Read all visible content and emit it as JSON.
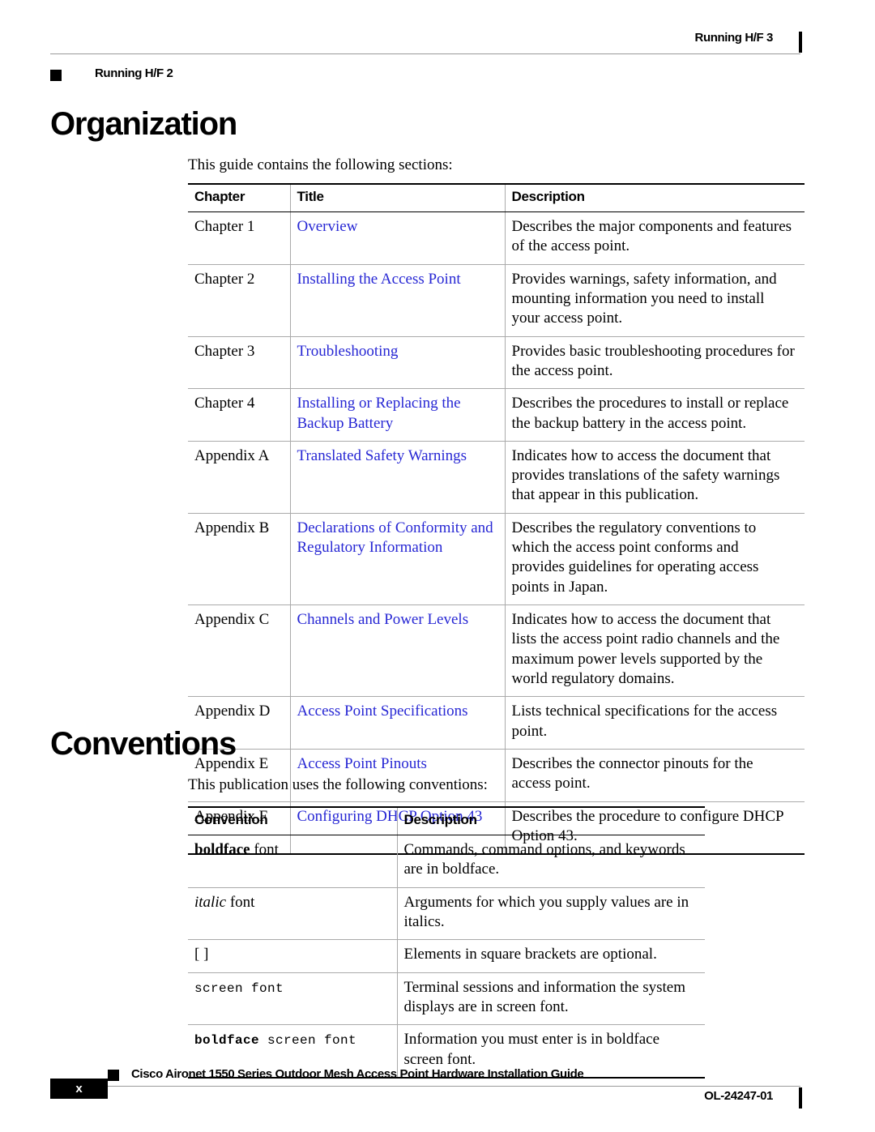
{
  "header": {
    "left_text": "Running H/F 2",
    "right_text": "Running H/F 3"
  },
  "footer": {
    "page_number": "x",
    "guide_title": "Cisco Aironet 1550 Series Outdoor Mesh Access Point Hardware Installation Guide",
    "doc_number": "OL-24247-01"
  },
  "colors": {
    "link": "#2727d4",
    "rule": "#9a9a9a",
    "text": "#000000"
  },
  "organization": {
    "title": "Organization",
    "lead": "This guide contains the following sections:",
    "headers": [
      "Chapter",
      "Title",
      "Description"
    ],
    "rows": [
      {
        "chapter": "Chapter 1",
        "title": "Overview",
        "description": "Describes the major components and features of the access point."
      },
      {
        "chapter": "Chapter 2",
        "title": "Installing the Access Point",
        "description": "Provides warnings, safety information, and mounting information you need to install your access point."
      },
      {
        "chapter": "Chapter 3",
        "title": "Troubleshooting",
        "description": "Provides basic troubleshooting procedures for the access point."
      },
      {
        "chapter": "Chapter 4",
        "title": "Installing or Replacing the Backup Battery",
        "description": "Describes the procedures to install or replace the backup battery in the access point."
      },
      {
        "chapter": "Appendix A",
        "title": "Translated Safety Warnings",
        "description": "Indicates how to access the document that provides translations of the safety warnings that appear in this publication."
      },
      {
        "chapter": "Appendix B",
        "title": "Declarations of Conformity and Regulatory Information",
        "description": "Describes the regulatory conventions to which the access point conforms and provides guidelines for operating access points in Japan."
      },
      {
        "chapter": "Appendix C",
        "title": "Channels and Power Levels",
        "description": "Indicates how to access the document that lists the access point radio channels and the maximum power levels supported by the world regulatory domains."
      },
      {
        "chapter": "Appendix D",
        "title": "Access Point Specifications",
        "description": " Lists technical specifications for the access point."
      },
      {
        "chapter": "Appendix E",
        "title": "Access Point Pinouts",
        "description": "Describes the connector pinouts for the access point."
      },
      {
        "chapter": "Appendix F",
        "title": "Configuring DHCP Option 43",
        "description": "Describes the procedure to configure DHCP Option 43."
      }
    ]
  },
  "conventions": {
    "title": "Conventions",
    "lead": "This publication uses the following conventions:",
    "headers": [
      "Convention",
      "Description"
    ],
    "rows": [
      {
        "convention_bold": "boldface",
        "convention_rest": " font",
        "style": "bold-serif",
        "description": "Commands, command options, and keywords are in boldface."
      },
      {
        "convention_bold": "italic",
        "convention_rest": " font",
        "style": "italic-serif",
        "description": "Arguments for which you supply values are in italics."
      },
      {
        "convention_bold": "[ ]",
        "convention_rest": "",
        "style": "plain-serif",
        "description": "Elements in square brackets are optional."
      },
      {
        "convention_bold": "screen font",
        "convention_rest": "",
        "style": "mono",
        "description": "Terminal sessions and information the system displays are in screen font."
      },
      {
        "convention_bold": "boldface",
        "convention_rest": " screen font",
        "style": "mono-bold",
        "description": "Information you must enter is in boldface screen font."
      }
    ]
  }
}
